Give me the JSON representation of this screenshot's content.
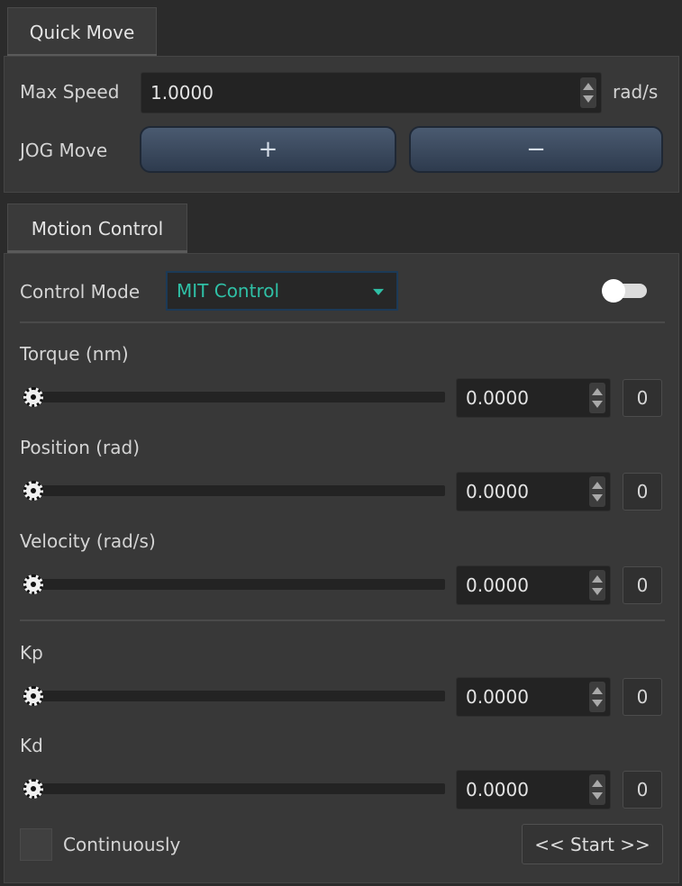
{
  "quick_move": {
    "tab_label": "Quick Move",
    "max_speed_label": "Max Speed",
    "max_speed_value": "1.0000",
    "max_speed_unit": "rad/s",
    "jog_label": "JOG Move",
    "jog_plus": "+",
    "jog_minus": "−"
  },
  "motion_control": {
    "tab_label": "Motion Control",
    "control_mode_label": "Control Mode",
    "control_mode_value": "MIT Control",
    "enabled_toggle": false,
    "params": [
      {
        "label": "Torque (nm)",
        "value": "0.0000",
        "reset_label": "0"
      },
      {
        "label": "Position (rad)",
        "value": "0.0000",
        "reset_label": "0"
      },
      {
        "label": "Velocity (rad/s)",
        "value": "0.0000",
        "reset_label": "0"
      },
      {
        "label": "Kp",
        "value": "0.0000",
        "reset_label": "0"
      },
      {
        "label": "Kd",
        "value": "0.0000",
        "reset_label": "0"
      }
    ],
    "continuously_label": "Continuously",
    "continuously_checked": false,
    "start_label": "<< Start >>"
  },
  "colors": {
    "accent": "#2fc0a6",
    "select_border": "#1c3a57",
    "jog_button": "#3d4b5f"
  },
  "icons": {
    "spin_arrows": "up-down-arrows-icon",
    "dropdown": "caret-down-icon",
    "slider_handle": "slider-handle-icon"
  }
}
